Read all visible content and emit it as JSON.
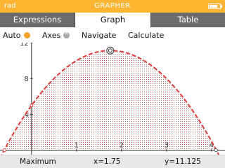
{
  "titlebar": {
    "mode": "rad",
    "app": "GRAPHER"
  },
  "tabs": [
    {
      "label": "Expressions"
    },
    {
      "label": "Graph"
    },
    {
      "label": "Table"
    }
  ],
  "toolbar": {
    "auto": "Auto",
    "axes": "Axes",
    "navigate": "Navigate",
    "calculate": "Calculate"
  },
  "colors": {
    "accent": "#ffb531",
    "curve": "#e23b3b",
    "fill_dots": "#b85050"
  },
  "chart_data": {
    "type": "area",
    "function": "y = -2x^2 + 7x + 5",
    "xlim": [
      -0.7,
      4.3
    ],
    "ylim": [
      -0.5,
      12
    ],
    "x_ticks": [
      "1",
      "2",
      "3",
      "4"
    ],
    "y_ticks": [
      "4",
      "8",
      "12"
    ],
    "maximum_point": {
      "x": 1.75,
      "y": 11.125
    },
    "integral_bounds": [
      -0.6,
      4.1
    ]
  },
  "status": {
    "label": "Maximum",
    "x": "x=1.75",
    "y": "y=11.125"
  }
}
